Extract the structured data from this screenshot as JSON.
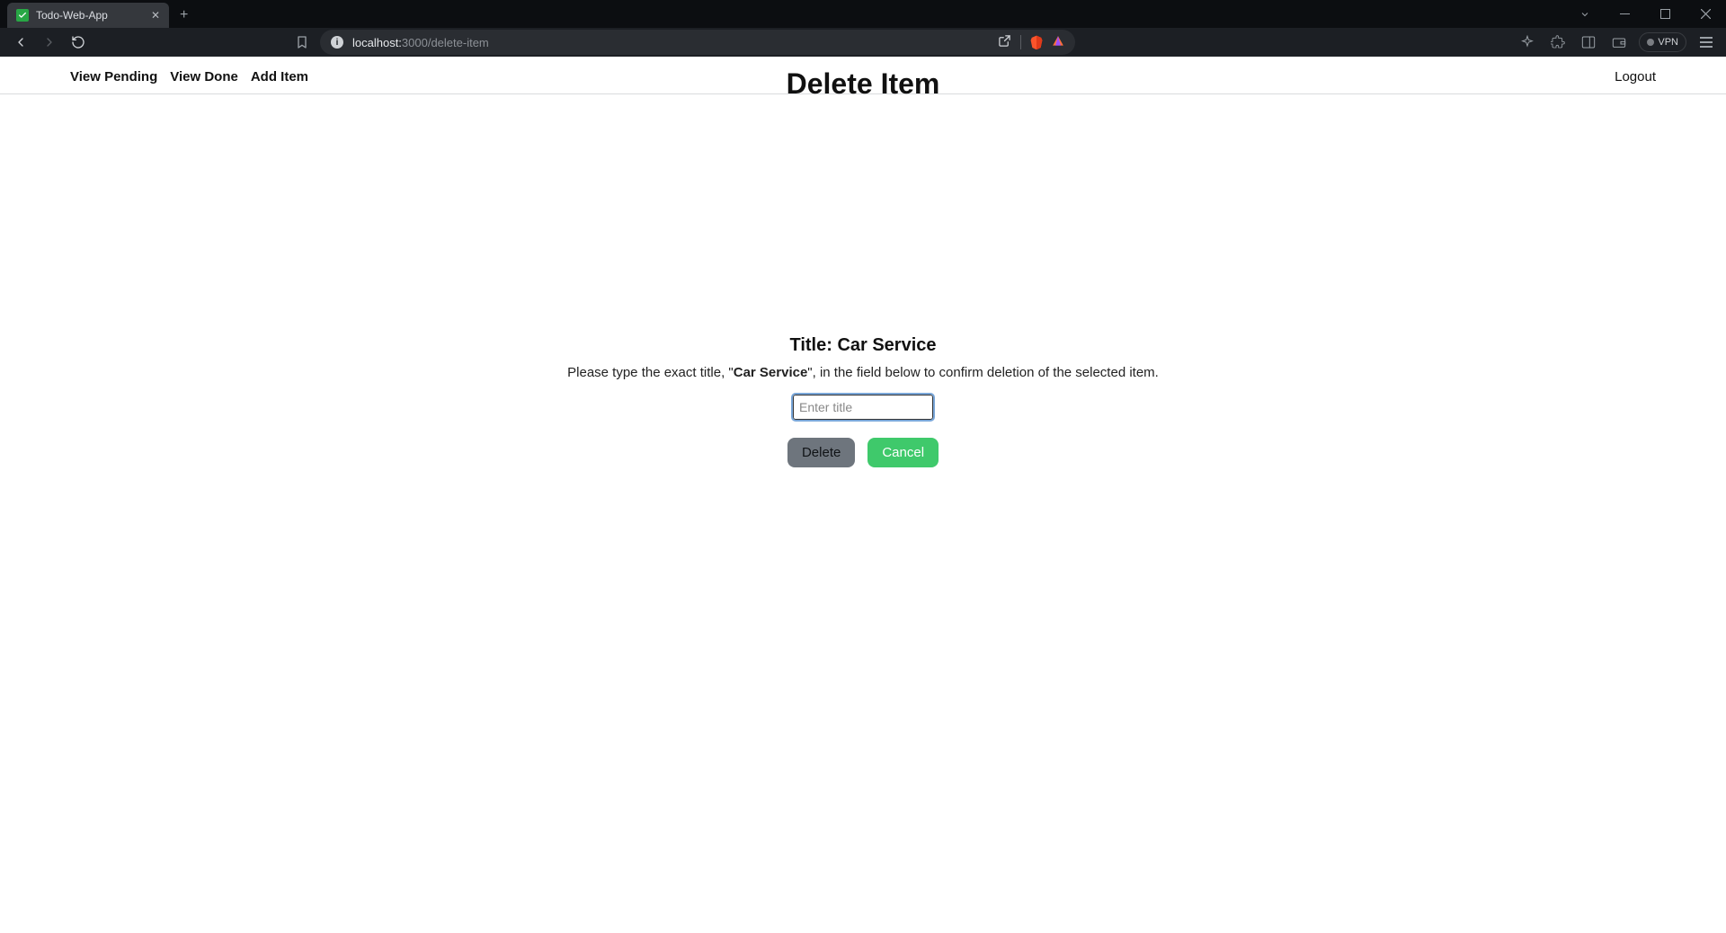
{
  "browser": {
    "tab_title": "Todo-Web-App",
    "url_host": "localhost:",
    "url_port_path": "3000/delete-item",
    "vpn_label": "VPN"
  },
  "header": {
    "nav": {
      "view_pending": "View Pending",
      "view_done": "View Done",
      "add_item": "Add Item"
    },
    "page_title": "Delete Item",
    "logout": "Logout"
  },
  "delete_form": {
    "title_prefix": "Title: ",
    "item_name": "Car Service",
    "instruction_pre": "Please type the exact title, \"",
    "instruction_bold": "Car Service",
    "instruction_post": "\", in the field below to confirm deletion of the selected item.",
    "input_placeholder": "Enter title",
    "input_value": "",
    "delete_label": "Delete",
    "cancel_label": "Cancel"
  }
}
